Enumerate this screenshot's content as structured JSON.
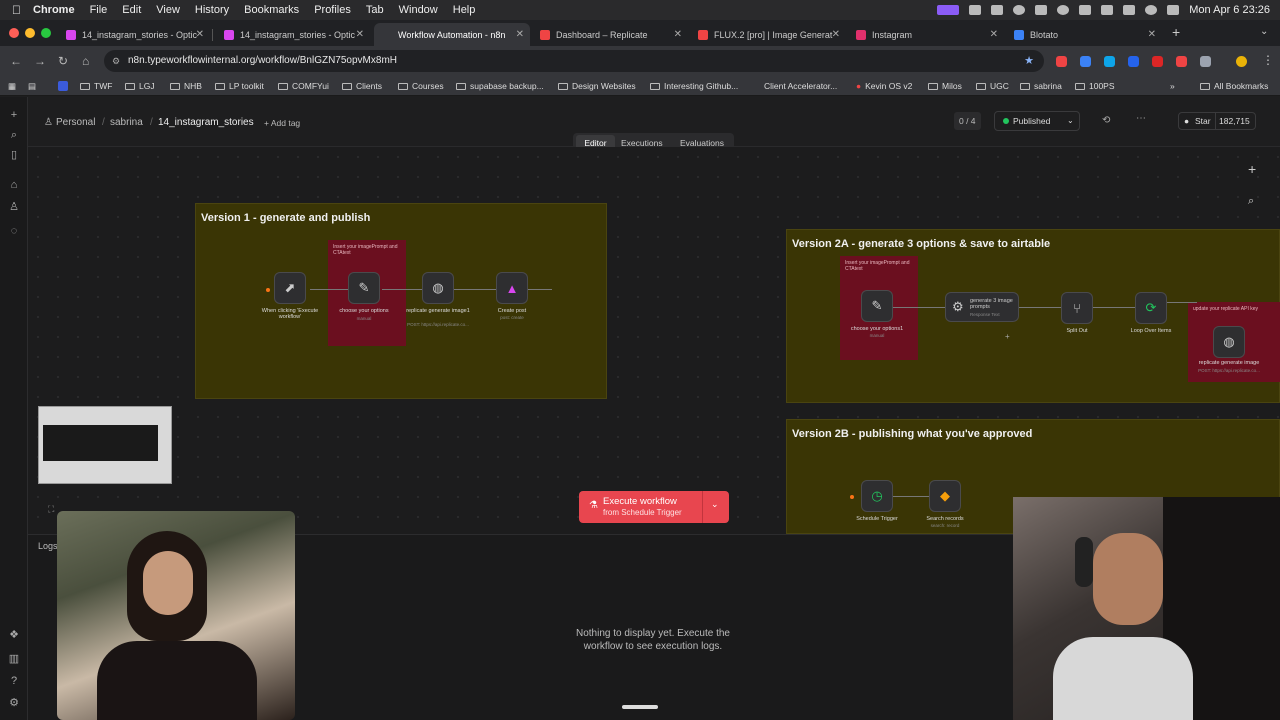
{
  "menubar": {
    "app": "Chrome",
    "items": [
      "File",
      "Edit",
      "View",
      "History",
      "Bookmarks",
      "Profiles",
      "Tab",
      "Window",
      "Help"
    ],
    "clock": "Mon Apr 6  23:26"
  },
  "tabs": [
    {
      "title": "14_instagram_stories - Optic",
      "color": "#d946ef"
    },
    {
      "title": "14_instagram_stories - Optic",
      "color": "#d946ef"
    },
    {
      "title": "Workflow Automation - n8n",
      "color": "#ea4b71"
    },
    {
      "title": "Dashboard – Replicate",
      "color": "#ef4444"
    },
    {
      "title": "FLUX.2 [pro] | Image Generat",
      "color": "#ef4444"
    },
    {
      "title": "Instagram",
      "color": "#e1306c"
    },
    {
      "title": "Blotato",
      "color": "#3b82f6"
    }
  ],
  "address": {
    "url": "n8n.typeworkflowinternal.org/workflow/BnlGZN75opvMx8mH"
  },
  "bookmarks": [
    "TWF",
    "LGJ",
    "NHB",
    "LP toolkit",
    "COMFYui",
    "Clients",
    "Courses",
    "supabase backup...",
    "Design Websites",
    "Interesting Github...",
    "Client Accelerator...",
    "Kevin OS v2",
    "Milos",
    "UGC",
    "sabrina",
    "100PS"
  ],
  "bookmarks_all": "All Bookmarks",
  "breadcrumb": {
    "personal": "Personal",
    "folder": "sabrina",
    "workflow": "14_instagram_stories",
    "add_tag": "+ Add tag"
  },
  "topbar": {
    "counter": "0 / 4",
    "status": "Published",
    "star": "Star",
    "star_count": "182,715"
  },
  "view_tabs": {
    "editor": "Editor",
    "executions": "Executions",
    "evaluations": "Evaluations"
  },
  "stickies": {
    "v1": "Version 1 - generate and publish",
    "v2a": "Version 2A - generate 3 options & save to airtable",
    "v2b": "Version 2B - publishing what you've approved"
  },
  "red_notes": {
    "v1": "Insert your imagePrompt and CTAtext",
    "v2a_left": "Insert your imagePrompt and CTAtext",
    "v2a_right": "update your replicate API key"
  },
  "nodes_v1": {
    "trigger": "When clicking 'Execute workflow'",
    "choose": "choose your options",
    "choose_sub": "manual",
    "replicate": "replicate generate image1",
    "replicate_sub": "POST: https://api.replicate.co...",
    "post": "Create post",
    "post_sub": "post: create"
  },
  "nodes_v2a": {
    "choose": "choose your options1",
    "choose_sub": "manual",
    "gen": "generate 3 image prompts",
    "gen_sub": "Response Text",
    "split": "Split Out",
    "loop": "Loop Over Items",
    "replicate": "replicate generate image",
    "replicate_sub": "POST: https://api.replicate.co..."
  },
  "nodes_v2b": {
    "schedule": "Schedule Trigger",
    "search": "Search records",
    "search_sub": "search: record"
  },
  "execute": {
    "label": "Execute workflow",
    "sub": "from Schedule Trigger"
  },
  "logs": {
    "tab": "Logs",
    "empty": "Nothing to display yet. Execute the workflow to see execution logs."
  }
}
